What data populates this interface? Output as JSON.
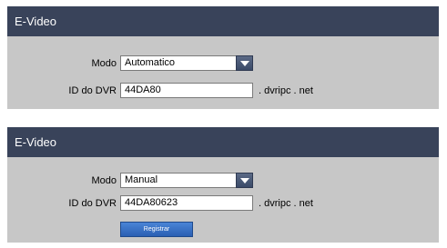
{
  "panels": [
    {
      "title": "E-Video",
      "modo_label": "Modo",
      "modo_value": "Automatico",
      "id_label": "ID do DVR",
      "id_value": "44DA80",
      "suffix": ". dvripc . net"
    },
    {
      "title": "E-Video",
      "modo_label": "Modo",
      "modo_value": "Manual",
      "id_label": "ID do DVR",
      "id_value": "44DA80623",
      "suffix": ". dvripc . net",
      "register_label": "Registrar"
    }
  ],
  "colors": {
    "header": "#39435a",
    "body": "#c7c7c7",
    "button": "#2a5fb3"
  }
}
